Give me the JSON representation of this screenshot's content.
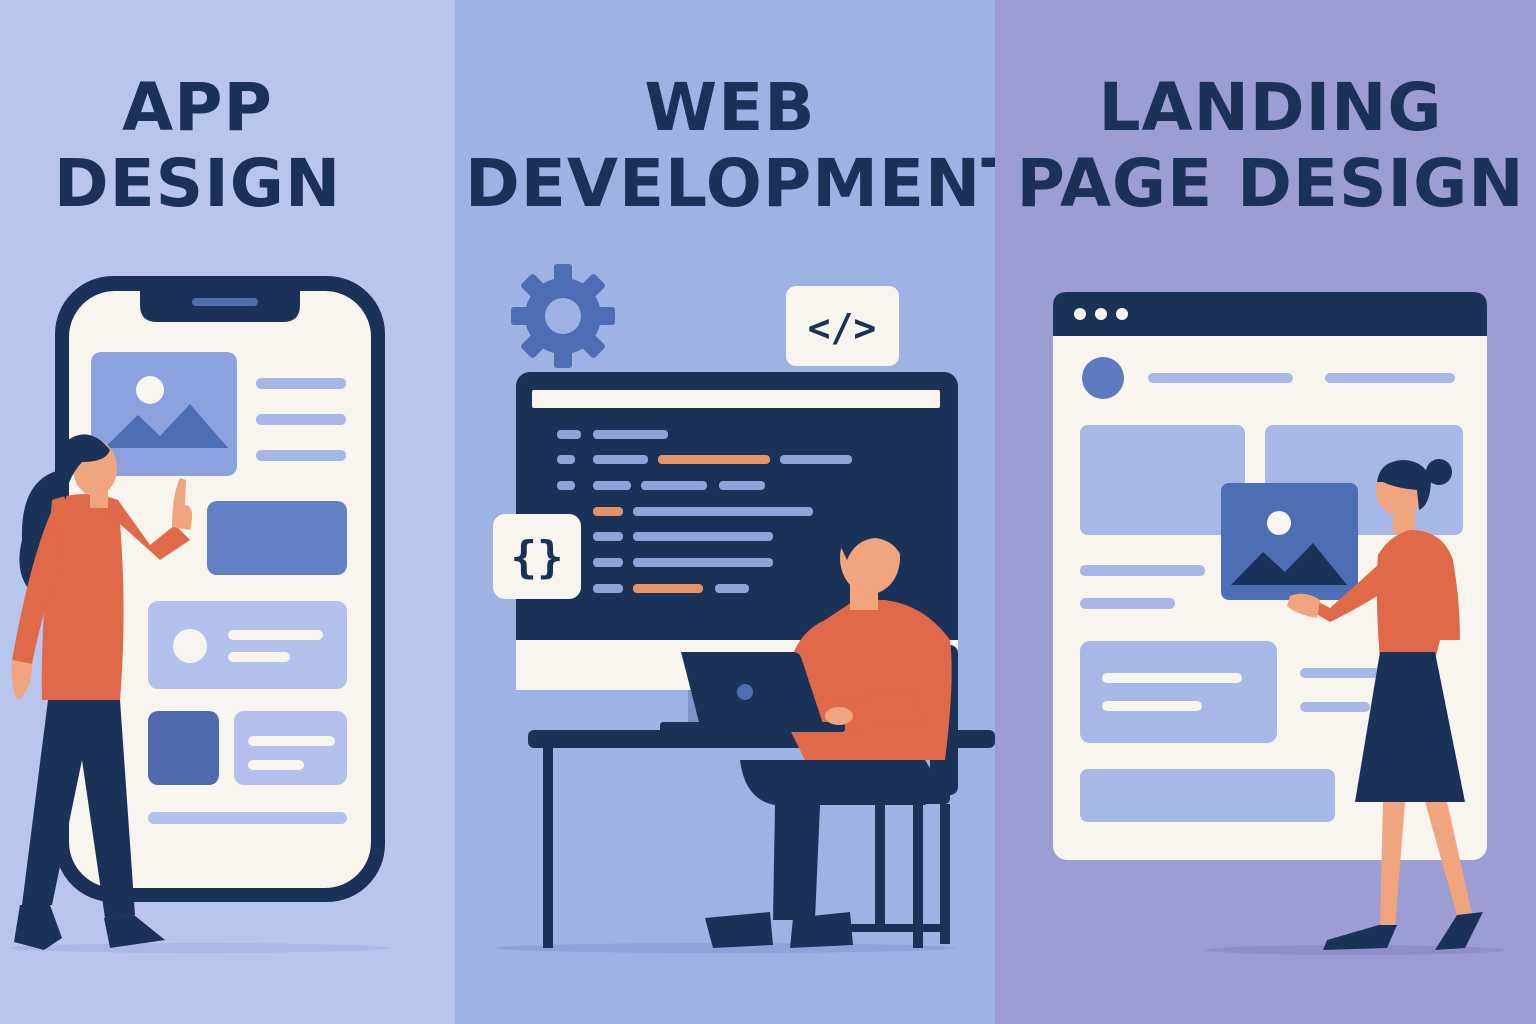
{
  "panels": [
    {
      "title_line1": "APP",
      "title_line2": "DESIGN"
    },
    {
      "title_line1": "WEB",
      "title_line2": "DEVELOPMENT"
    },
    {
      "title_line1": "LANDING",
      "title_line2": "PAGE DESIGN"
    }
  ],
  "icons": {
    "code_badge": "</>",
    "braces_badge": "{}"
  },
  "colors": {
    "navy": "#1b3258",
    "orange": "#e0694a",
    "panel_app": "#b8c6ee",
    "panel_web": "#9eb2e3",
    "panel_landing": "#9c9dd3",
    "accent_blue": "#4d6db5"
  }
}
